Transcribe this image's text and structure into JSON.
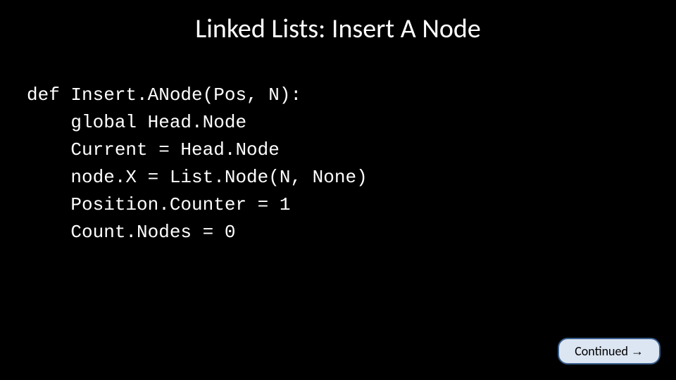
{
  "title": "Linked Lists: Insert A Node",
  "code": {
    "line1": "def Insert.ANode(Pos, N):",
    "line2": "    global Head.Node",
    "line3": "    Current = Head.Node",
    "line4": "    node.X = List.Node(N, None)",
    "line5": "    Position.Counter = 1",
    "line6": "    Count.Nodes = 0"
  },
  "button": {
    "label": "Continued ",
    "arrow": "→"
  }
}
